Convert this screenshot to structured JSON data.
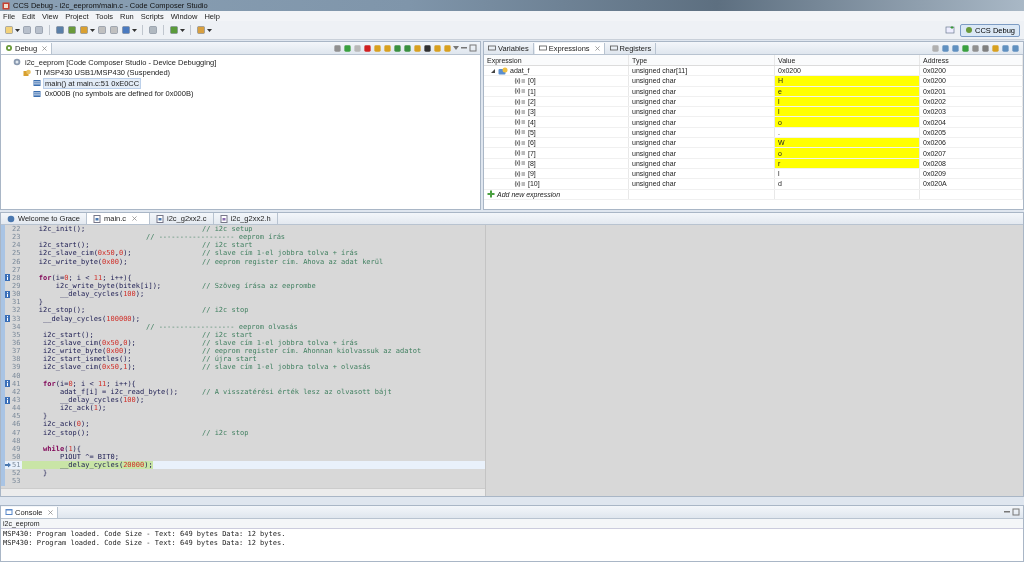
{
  "window": {
    "title": "CCS Debug - i2c_eeprom/main.c - Code Composer Studio"
  },
  "menu": [
    "File",
    "Edit",
    "View",
    "Project",
    "Tools",
    "Run",
    "Scripts",
    "Window",
    "Help"
  ],
  "perspective": {
    "label": "CCS Debug",
    "selected": true
  },
  "debug_view": {
    "tab": "Debug",
    "tree": [
      {
        "label": "i2c_eeprom [Code Composer Studio - Device Debugging]",
        "kind": "launch",
        "selected": false,
        "children": [
          {
            "label": "TI MSP430 USB1/MSP430 (Suspended)",
            "kind": "target",
            "selected": false,
            "children": [
              {
                "label": "main() at main.c:51 0xE0CC",
                "kind": "frame",
                "selected": true
              },
              {
                "label": "0x000B  (no symbols are defined for 0x000B)",
                "kind": "frame",
                "selected": false
              }
            ]
          }
        ]
      }
    ]
  },
  "expressions_view": {
    "tabs": [
      {
        "label": "Variables",
        "selected": false
      },
      {
        "label": "Expressions",
        "selected": true
      },
      {
        "label": "Registers",
        "selected": false
      }
    ],
    "columns": [
      "Expression",
      "Type",
      "Value",
      "Address"
    ],
    "rows": [
      {
        "expression": "adat_f",
        "type": "unsigned char[11]",
        "value": "0x0200",
        "address": "0x0200",
        "changed": false,
        "expanded": true,
        "children": [
          {
            "expression": "[0]",
            "type": "unsigned char",
            "value": "H",
            "address": "0x0200",
            "changed": true
          },
          {
            "expression": "[1]",
            "type": "unsigned char",
            "value": "e",
            "address": "0x0201",
            "changed": true
          },
          {
            "expression": "[2]",
            "type": "unsigned char",
            "value": "l",
            "address": "0x0202",
            "changed": true
          },
          {
            "expression": "[3]",
            "type": "unsigned char",
            "value": "l",
            "address": "0x0203",
            "changed": true
          },
          {
            "expression": "[4]",
            "type": "unsigned char",
            "value": "o",
            "address": "0x0204",
            "changed": true
          },
          {
            "expression": "[5]",
            "type": "unsigned char",
            "value": ".",
            "address": "0x0205",
            "changed": false
          },
          {
            "expression": "[6]",
            "type": "unsigned char",
            "value": "W",
            "address": "0x0206",
            "changed": true
          },
          {
            "expression": "[7]",
            "type": "unsigned char",
            "value": "o",
            "address": "0x0207",
            "changed": true
          },
          {
            "expression": "[8]",
            "type": "unsigned char",
            "value": "r",
            "address": "0x0208",
            "changed": true
          },
          {
            "expression": "[9]",
            "type": "unsigned char",
            "value": "l",
            "address": "0x0209",
            "changed": false
          },
          {
            "expression": "[10]",
            "type": "unsigned char",
            "value": "d",
            "address": "0x020A",
            "changed": false
          }
        ]
      }
    ],
    "add_label": "Add new expression"
  },
  "editor": {
    "tabs": [
      {
        "label": "Welcome to Grace",
        "kind": "welcome",
        "selected": false
      },
      {
        "label": "main.c",
        "kind": "c",
        "selected": true
      },
      {
        "label": "i2c_g2xx2.c",
        "kind": "c",
        "selected": false
      },
      {
        "label": "i2c_g2xx2.h",
        "kind": "h",
        "selected": false
      }
    ],
    "lines": [
      {
        "number": "22",
        "code": [
          {
            "kind": "plain",
            "text": "    i2c_init();"
          }
        ],
        "comment": "// i2c setup",
        "bookmark": false,
        "current": false
      },
      {
        "number": "23",
        "section": "// ------------------ eeprom írás",
        "bookmark": false,
        "current": false
      },
      {
        "number": "24",
        "code": [
          {
            "kind": "plain",
            "text": "    i2c_start();"
          }
        ],
        "comment": "// i2c start",
        "bookmark": false,
        "current": false
      },
      {
        "number": "25",
        "code": [
          {
            "kind": "plain",
            "text": "    i2c_slave_cim("
          },
          {
            "kind": "number",
            "text": "0x50"
          },
          {
            "kind": "plain",
            "text": ","
          },
          {
            "kind": "number",
            "text": "0"
          },
          {
            "kind": "plain",
            "text": ");"
          }
        ],
        "comment": "// slave cím 1-el jobbra tolva + írás",
        "bookmark": false,
        "current": false
      },
      {
        "number": "26",
        "code": [
          {
            "kind": "plain",
            "text": "    i2c_write_byte("
          },
          {
            "kind": "number",
            "text": "0x00"
          },
          {
            "kind": "plain",
            "text": ");"
          }
        ],
        "comment": "// eeprom register cím. Ahova az adat kerül",
        "bookmark": false,
        "current": false
      },
      {
        "number": "27",
        "bookmark": false,
        "current": false
      },
      {
        "number": "28",
        "code": [
          {
            "kind": "keyword",
            "text": "    for"
          },
          {
            "kind": "plain",
            "text": "(i="
          },
          {
            "kind": "number",
            "text": "0"
          },
          {
            "kind": "plain",
            "text": "; i < "
          },
          {
            "kind": "number",
            "text": "11"
          },
          {
            "kind": "plain",
            "text": "; i++){"
          }
        ],
        "bookmark": true,
        "current": false
      },
      {
        "number": "29",
        "code": [
          {
            "kind": "plain",
            "text": "        i2c_write_byte(bitek[i]);"
          }
        ],
        "comment": "// Szöveg írása az eeprombe",
        "bookmark": false,
        "current": false
      },
      {
        "number": "30",
        "code": [
          {
            "kind": "plain",
            "text": "         __delay_cycles("
          },
          {
            "kind": "number",
            "text": "100"
          },
          {
            "kind": "plain",
            "text": ");"
          }
        ],
        "bookmark": true,
        "current": false
      },
      {
        "number": "31",
        "code": [
          {
            "kind": "plain",
            "text": "    }"
          }
        ],
        "bookmark": false,
        "current": false
      },
      {
        "number": "32",
        "code": [
          {
            "kind": "plain",
            "text": "    i2c_stop();"
          }
        ],
        "comment": "// i2c stop",
        "bookmark": false,
        "current": false
      },
      {
        "number": "33",
        "code": [
          {
            "kind": "plain",
            "text": "     __delay_cycles("
          },
          {
            "kind": "number",
            "text": "100000"
          },
          {
            "kind": "plain",
            "text": ");"
          }
        ],
        "bookmark": true,
        "current": false
      },
      {
        "number": "34",
        "section": "// ------------------ eeprom olvasás",
        "bookmark": false,
        "current": false
      },
      {
        "number": "35",
        "code": [
          {
            "kind": "plain",
            "text": "     i2c_start();"
          }
        ],
        "comment": "// i2c start",
        "bookmark": false,
        "current": false
      },
      {
        "number": "36",
        "code": [
          {
            "kind": "plain",
            "text": "     i2c_slave_cim("
          },
          {
            "kind": "number",
            "text": "0x50"
          },
          {
            "kind": "plain",
            "text": ","
          },
          {
            "kind": "number",
            "text": "0"
          },
          {
            "kind": "plain",
            "text": ");"
          }
        ],
        "comment": "// slave cím 1-el jobbra tolva + írás",
        "bookmark": false,
        "current": false
      },
      {
        "number": "37",
        "code": [
          {
            "kind": "plain",
            "text": "     i2c_write_byte("
          },
          {
            "kind": "number",
            "text": "0x00"
          },
          {
            "kind": "plain",
            "text": ");"
          }
        ],
        "comment": "// eeprom register cím. Ahonnan kiolvassuk az adatot",
        "bookmark": false,
        "current": false
      },
      {
        "number": "38",
        "code": [
          {
            "kind": "plain",
            "text": "     i2c_start_ismetles();"
          }
        ],
        "comment": "// újra start",
        "bookmark": false,
        "current": false
      },
      {
        "number": "39",
        "code": [
          {
            "kind": "plain",
            "text": "     i2c_slave_cim("
          },
          {
            "kind": "number",
            "text": "0x50"
          },
          {
            "kind": "plain",
            "text": ","
          },
          {
            "kind": "number",
            "text": "1"
          },
          {
            "kind": "plain",
            "text": ");"
          }
        ],
        "comment": "// slave cím 1-el jobbra tolva + olvasás",
        "bookmark": false,
        "current": false
      },
      {
        "number": "40",
        "bookmark": false,
        "current": false
      },
      {
        "number": "41",
        "code": [
          {
            "kind": "keyword",
            "text": "     for"
          },
          {
            "kind": "plain",
            "text": "(i="
          },
          {
            "kind": "number",
            "text": "0"
          },
          {
            "kind": "plain",
            "text": "; i < "
          },
          {
            "kind": "number",
            "text": "11"
          },
          {
            "kind": "plain",
            "text": "; i++){"
          }
        ],
        "bookmark": true,
        "current": false
      },
      {
        "number": "42",
        "code": [
          {
            "kind": "plain",
            "text": "         adat_f[i] = i2c_read_byte();"
          }
        ],
        "comment": "// A visszatérési érték lesz az olvasott bájt",
        "bookmark": false,
        "current": false
      },
      {
        "number": "43",
        "code": [
          {
            "kind": "plain",
            "text": "         __delay_cycles("
          },
          {
            "kind": "number",
            "text": "100"
          },
          {
            "kind": "plain",
            "text": ");"
          }
        ],
        "bookmark": true,
        "current": false
      },
      {
        "number": "44",
        "code": [
          {
            "kind": "plain",
            "text": "         i2c_ack("
          },
          {
            "kind": "number",
            "text": "1"
          },
          {
            "kind": "plain",
            "text": ");"
          }
        ],
        "bookmark": false,
        "current": false
      },
      {
        "number": "45",
        "code": [
          {
            "kind": "plain",
            "text": "     }"
          }
        ],
        "bookmark": false,
        "current": false
      },
      {
        "number": "46",
        "code": [
          {
            "kind": "plain",
            "text": "     i2c_ack("
          },
          {
            "kind": "number",
            "text": "0"
          },
          {
            "kind": "plain",
            "text": ");"
          }
        ],
        "bookmark": false,
        "current": false
      },
      {
        "number": "47",
        "code": [
          {
            "kind": "plain",
            "text": "     i2c_stop();"
          }
        ],
        "comment": "// i2c stop",
        "bookmark": false,
        "current": false
      },
      {
        "number": "48",
        "bookmark": false,
        "current": false
      },
      {
        "number": "49",
        "code": [
          {
            "kind": "keyword",
            "text": "     while"
          },
          {
            "kind": "plain",
            "text": "("
          },
          {
            "kind": "number",
            "text": "1"
          },
          {
            "kind": "plain",
            "text": "){"
          }
        ],
        "bookmark": false,
        "current": false
      },
      {
        "number": "50",
        "code": [
          {
            "kind": "plain",
            "text": "         P1OUT ^= BIT0;"
          }
        ],
        "bookmark": false,
        "current": false
      },
      {
        "number": "51",
        "code": [
          {
            "kind": "plain",
            "text": "         __delay_cycles("
          },
          {
            "kind": "number",
            "text": "20000"
          },
          {
            "kind": "plain",
            "text": ");"
          }
        ],
        "bookmark": false,
        "current": true
      },
      {
        "number": "52",
        "code": [
          {
            "kind": "plain",
            "text": "     }"
          }
        ],
        "bookmark": false,
        "current": false
      },
      {
        "number": "53",
        "bookmark": false,
        "current": false
      }
    ]
  },
  "console": {
    "tab": "Console",
    "process": "i2c_eeprom",
    "lines": [
      "MSP430: Program loaded. Code Size - Text: 649 bytes Data: 12 bytes.",
      "MSP430: Program loaded. Code Size - Text: 649 bytes Data: 12 bytes."
    ]
  }
}
